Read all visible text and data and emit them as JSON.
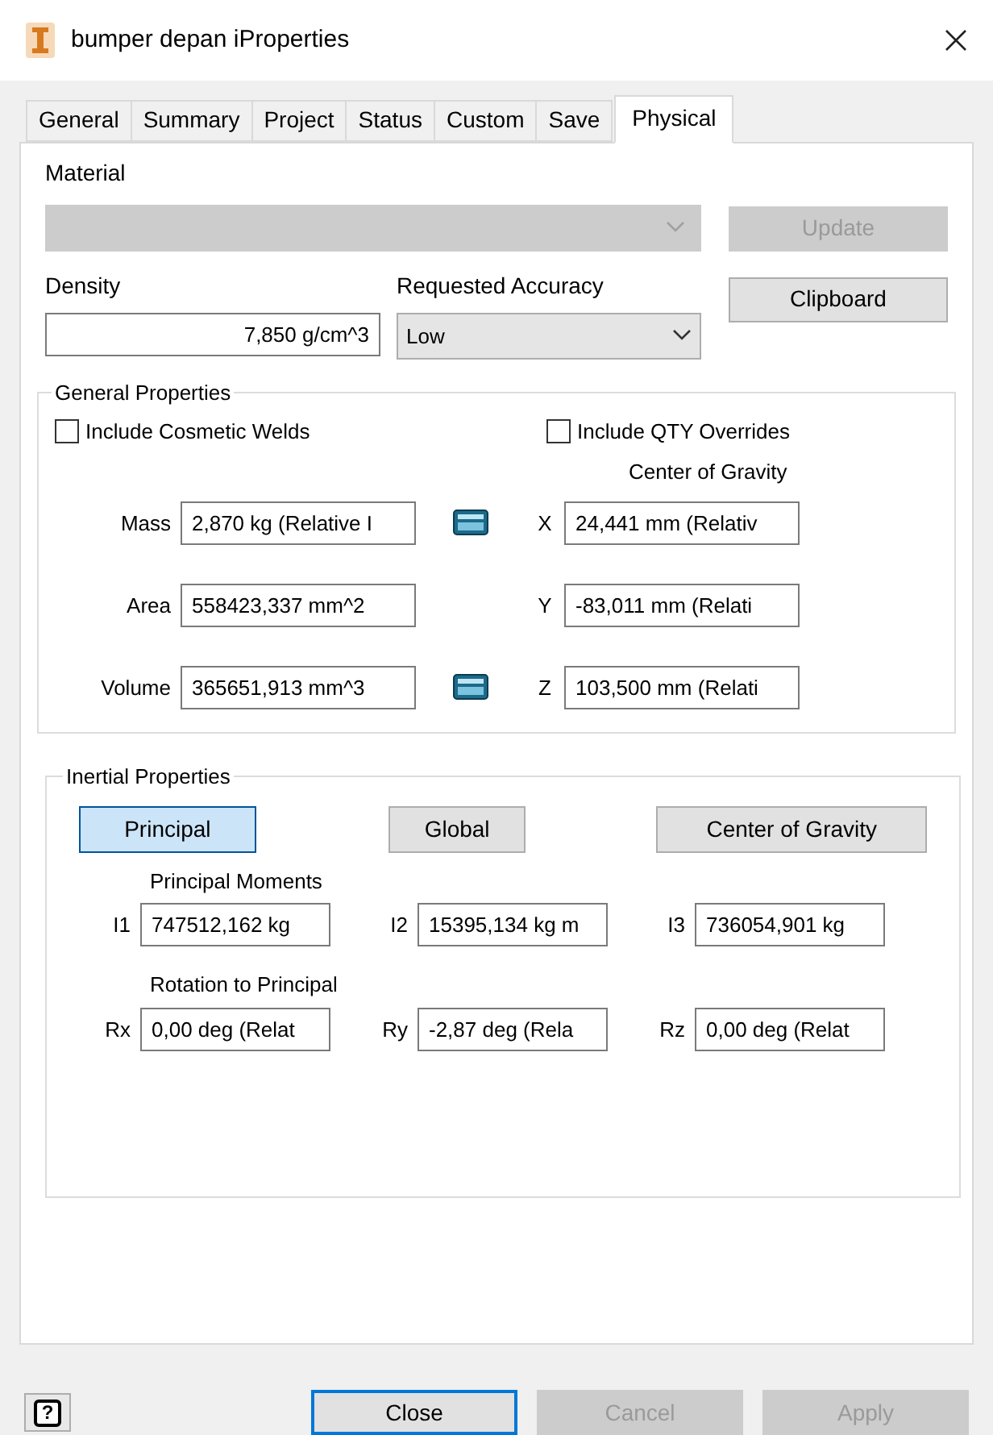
{
  "window": {
    "title": "bumper depan iProperties"
  },
  "tabs": [
    {
      "label": "General",
      "selected": false
    },
    {
      "label": "Summary",
      "selected": false
    },
    {
      "label": "Project",
      "selected": false
    },
    {
      "label": "Status",
      "selected": false
    },
    {
      "label": "Custom",
      "selected": false
    },
    {
      "label": "Save",
      "selected": false
    },
    {
      "label": "Physical",
      "selected": true
    }
  ],
  "material": {
    "label": "Material",
    "disabled": true
  },
  "update_button": {
    "label": "Update",
    "disabled": true
  },
  "density": {
    "label": "Density",
    "value": "7,850 g/cm^3"
  },
  "accuracy": {
    "label": "Requested Accuracy",
    "value": "Low"
  },
  "clipboard_button": {
    "label": "Clipboard",
    "disabled": false
  },
  "general_properties": {
    "title": "General Properties",
    "checkboxes": [
      {
        "label": "Include Cosmetic Welds",
        "checked": false
      },
      {
        "label": "Include QTY Overrides",
        "checked": false
      }
    ],
    "center_of_gravity_label": "Center of Gravity",
    "rows": [
      {
        "label": "Mass",
        "value": "2,870 kg (Relative I",
        "calculator": true,
        "cog_label": "X",
        "cog_value": "24,441 mm (Relativ"
      },
      {
        "label": "Area",
        "value": "558423,337 mm^2",
        "calculator": false,
        "cog_label": "Y",
        "cog_value": "-83,011 mm (Relati"
      },
      {
        "label": "Volume",
        "value": "365651,913 mm^3",
        "calculator": true,
        "cog_label": "Z",
        "cog_value": "103,500 mm (Relati"
      }
    ]
  },
  "inertial_properties": {
    "title": "Inertial Properties",
    "buttons": [
      {
        "label": "Principal",
        "selected": true
      },
      {
        "label": "Global",
        "selected": false
      },
      {
        "label": "Center of Gravity",
        "selected": false
      }
    ],
    "moments_label": "Principal Moments",
    "moments": [
      {
        "label": "I1",
        "value": "747512,162 kg"
      },
      {
        "label": "I2",
        "value": "15395,134 kg m"
      },
      {
        "label": "I3",
        "value": "736054,901 kg"
      }
    ],
    "rotation_label": "Rotation to Principal",
    "rotations": [
      {
        "label": "Rx",
        "value": "0,00 deg (Relat"
      },
      {
        "label": "Ry",
        "value": "-2,87 deg (Rela"
      },
      {
        "label": "Rz",
        "value": "0,00 deg (Relat"
      }
    ]
  },
  "help_button": "?",
  "footer_buttons": [
    {
      "label": "Close",
      "disabled": false
    },
    {
      "label": "Cancel",
      "disabled": true
    },
    {
      "label": "Apply",
      "disabled": true
    }
  ]
}
